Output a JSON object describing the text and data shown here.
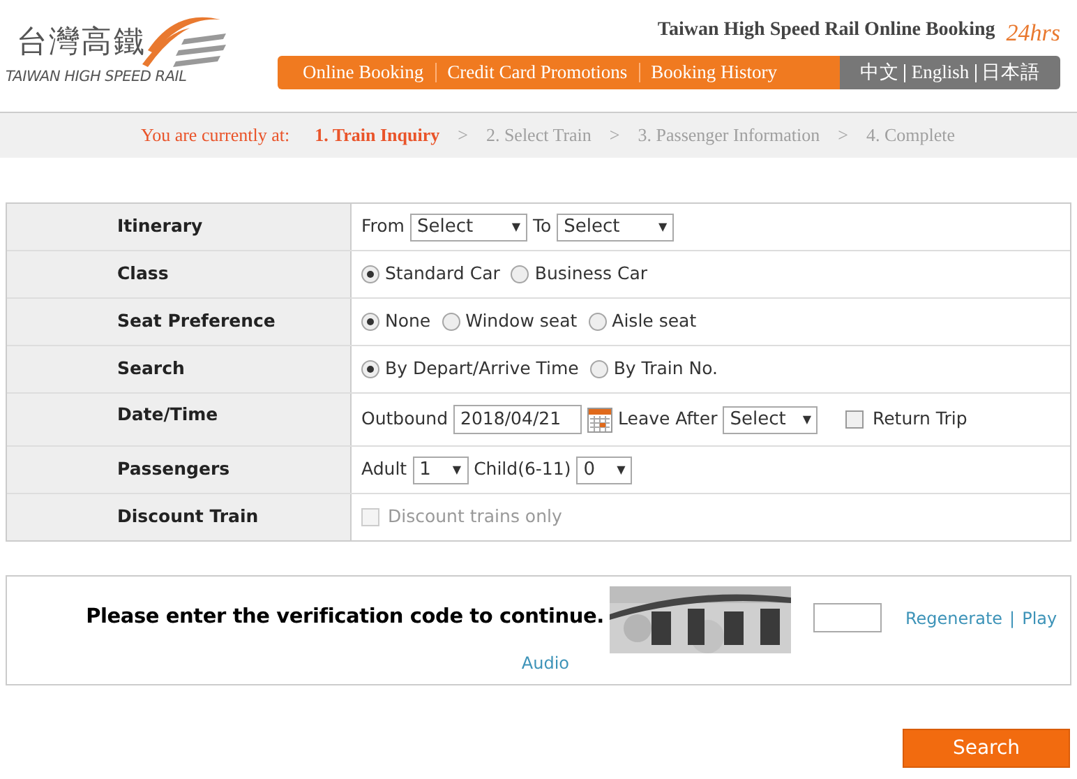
{
  "header": {
    "logo_cn": "台灣高鐵",
    "logo_en": "TAIWAN HIGH SPEED RAIL",
    "title": "Taiwan High Speed Rail Online Booking",
    "badge": "24hrs"
  },
  "nav": {
    "items": [
      {
        "label": "Online Booking",
        "selected": false
      },
      {
        "label": "Credit Card Promotions",
        "selected": false
      },
      {
        "label": "Booking History",
        "selected": false
      }
    ],
    "languages": [
      "中文",
      "English",
      "日本語"
    ]
  },
  "breadcrumb": {
    "prefix": "You are currently at:",
    "separator": ">",
    "steps": [
      {
        "label": "1. Train Inquiry",
        "selected": true
      },
      {
        "label": "2. Select Train",
        "selected": false
      },
      {
        "label": "3. Passenger Information",
        "selected": false
      },
      {
        "label": "4. Complete",
        "selected": false
      }
    ]
  },
  "form_rows": [
    {
      "label": "Itinerary",
      "controls": [
        {
          "kind": "text",
          "text": "From"
        },
        {
          "kind": "select",
          "value": "Select",
          "arrow": "▼",
          "wide": true
        },
        {
          "kind": "text",
          "text": "To"
        },
        {
          "kind": "select",
          "value": "Select",
          "arrow": "▼",
          "wide": true
        }
      ]
    },
    {
      "label": "Class",
      "controls": [
        {
          "kind": "radio",
          "text": "Standard Car",
          "selected": true
        },
        {
          "kind": "radio",
          "text": "Business Car",
          "selected": false
        }
      ]
    },
    {
      "label": "Seat Preference",
      "controls": [
        {
          "kind": "radio",
          "text": "None",
          "selected": true
        },
        {
          "kind": "radio",
          "text": "Window seat",
          "selected": false
        },
        {
          "kind": "radio",
          "text": "Aisle seat",
          "selected": false
        }
      ]
    },
    {
      "label": "Search",
      "controls": [
        {
          "kind": "radio",
          "text": "By Depart/Arrive Time",
          "selected": true
        },
        {
          "kind": "radio",
          "text": "By Train No.",
          "selected": false
        }
      ]
    },
    {
      "label": "Date/Time",
      "controls": [
        {
          "kind": "text",
          "text": "Outbound"
        },
        {
          "kind": "date",
          "value": "2018/04/21"
        },
        {
          "kind": "text",
          "text": "Leave After"
        },
        {
          "kind": "select",
          "value": "Select",
          "arrow": "▼",
          "wide": false
        },
        {
          "kind": "checkbox",
          "text": "Return Trip",
          "checked": false,
          "disabled": false
        }
      ]
    },
    {
      "label": "Passengers",
      "controls": [
        {
          "kind": "text",
          "text": "Adult"
        },
        {
          "kind": "select",
          "value": "1",
          "arrow": "▼",
          "wide": false
        },
        {
          "kind": "text",
          "text": "Child(6-11)"
        },
        {
          "kind": "select",
          "value": "0",
          "arrow": "▼",
          "wide": false
        }
      ]
    },
    {
      "label": "Discount Train",
      "controls": [
        {
          "kind": "checkbox",
          "text": "Discount trains only",
          "checked": false,
          "disabled": true
        }
      ]
    }
  ],
  "verification": {
    "prompt": "Please enter the verification code to continue.",
    "captcha": {
      "kind": "picture"
    },
    "links": [
      "Regenerate",
      "Play",
      "Audio"
    ],
    "separator": "|"
  },
  "submit": "Search"
}
